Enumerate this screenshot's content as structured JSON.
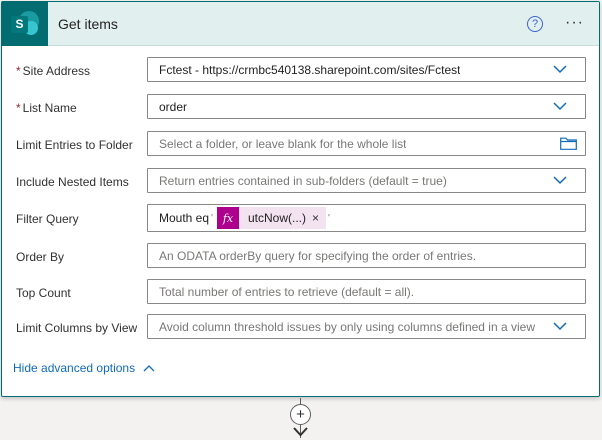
{
  "action": {
    "title": "Get items",
    "help_icon": "help-circle-icon",
    "help_glyph": "?",
    "more_icon": "ellipsis-icon",
    "more_glyph": "···",
    "logo_letter": "S"
  },
  "fields": {
    "site_address": {
      "label": "Site Address",
      "required": "*",
      "value": "Fctest - https://crmbc540138.sharepoint.com/sites/Fctest"
    },
    "list_name": {
      "label": "List Name",
      "required": "*",
      "value": "order"
    },
    "limit_folder": {
      "label": "Limit Entries to Folder",
      "placeholder": "Select a folder, or leave blank for the whole list"
    },
    "nested_items": {
      "label": "Include Nested Items",
      "placeholder": "Return entries contained in sub-folders (default = true)"
    },
    "filter_query": {
      "label": "Filter Query",
      "prefix": "Mouth eq",
      "tick_before": "'",
      "token_fx": "fx",
      "token_label": "utcNow(...)",
      "token_close": "×",
      "tick_after": "'"
    },
    "order_by": {
      "label": "Order By",
      "placeholder": "An ODATA orderBy query for specifying the order of entries."
    },
    "top_count": {
      "label": "Top Count",
      "placeholder": "Total number of entries to retrieve (default = all)."
    },
    "limit_columns": {
      "label": "Limit Columns by View",
      "placeholder": "Avoid column threshold issues by only using columns defined in a view"
    }
  },
  "advanced_toggle": "Hide advanced options",
  "connector": {
    "plus_glyph": "+"
  },
  "colors": {
    "brand": "#036c70",
    "header_bg": "#e1efee",
    "token_accent": "#ad008c",
    "link": "#0f6cbd",
    "required": "#a4262c"
  }
}
